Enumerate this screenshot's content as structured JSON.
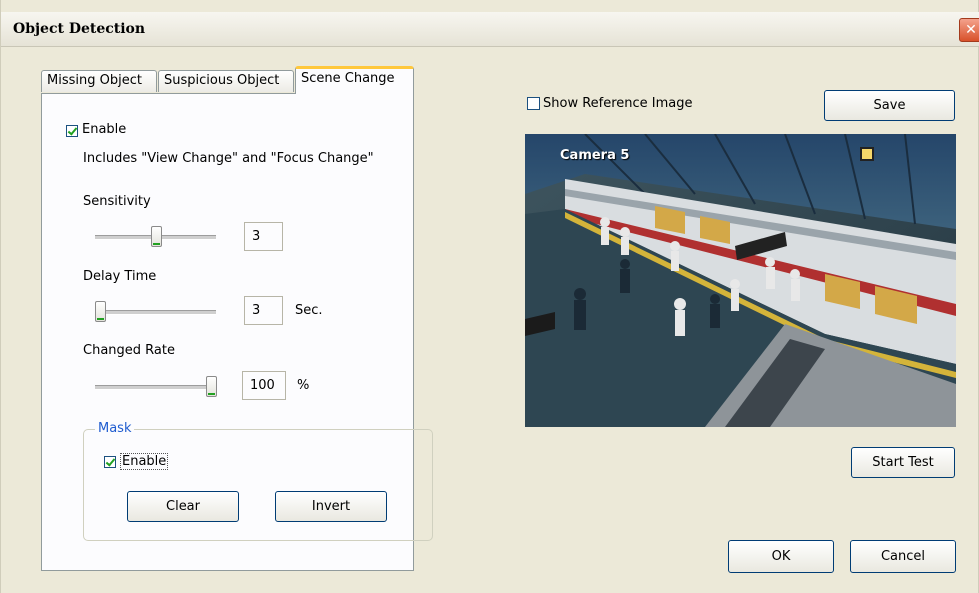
{
  "window": {
    "title": "Object Detection",
    "close_label": "✕"
  },
  "tabs": [
    {
      "label": "Missing Object",
      "active": false
    },
    {
      "label": "Suspicious Object",
      "active": false
    },
    {
      "label": "Scene Change",
      "active": true
    }
  ],
  "scene_change": {
    "enable_label": "Enable",
    "enable_checked": true,
    "description": "Includes \"View Change\" and \"Focus Change\"",
    "sensitivity": {
      "label": "Sensitivity",
      "value": "3"
    },
    "delay_time": {
      "label": "Delay Time",
      "value": "3",
      "unit": "Sec."
    },
    "changed_rate": {
      "label": "Changed Rate",
      "value": "100",
      "unit": "%"
    },
    "mask": {
      "legend": "Mask",
      "enable_label": "Enable",
      "enable_checked": true,
      "clear_label": "Clear",
      "invert_label": "Invert"
    }
  },
  "preview": {
    "show_reference_label": "Show Reference Image",
    "show_reference_checked": false,
    "save_label": "Save",
    "camera_label": "Camera 5",
    "start_test_label": "Start Test"
  },
  "footer": {
    "ok_label": "OK",
    "cancel_label": "Cancel"
  },
  "colors": {
    "tab_highlight": "#ffc83c",
    "check_mark": "#21a121",
    "group_legend": "#1f5ccf"
  }
}
